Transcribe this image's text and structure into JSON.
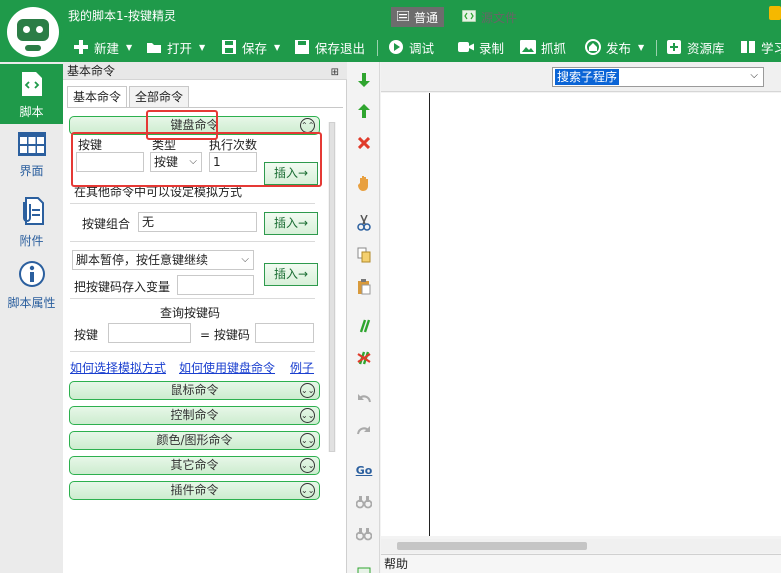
{
  "window": {
    "title": "我的脚本1-按键精灵"
  },
  "toolbar": {
    "new": "新建",
    "open": "打开",
    "save": "保存",
    "save_exit": "保存退出",
    "debug": "调试",
    "record": "录制",
    "capture": "抓抓",
    "publish": "发布",
    "resources": "资源库",
    "learn": "学习"
  },
  "leftnav": {
    "items": [
      {
        "label": "脚本"
      },
      {
        "label": "界面"
      },
      {
        "label": "附件"
      },
      {
        "label": "脚本属性"
      }
    ]
  },
  "panel": {
    "header": "基本命令",
    "tabs": [
      "基本命令",
      "全部命令"
    ],
    "keyboard_section": "键盘命令",
    "key_label": "按键",
    "type_label": "类型",
    "times_label": "执行次数",
    "type_value": "按键",
    "times_value": "1",
    "insert": "插入→",
    "note": "在其他命令中可以设定模拟方式",
    "combo_label": "按键组合",
    "combo_value": "无",
    "pause_select": "脚本暂停，按任意键继续",
    "store_var_label": "把按键码存入变量",
    "query_title": "查询按键码",
    "query_key_label": "按键",
    "query_code_label": "= 按键码",
    "links": [
      "如何选择模拟方式",
      "如何使用键盘命令",
      "例子"
    ],
    "sections": [
      "鼠标命令",
      "控制命令",
      "颜色/图形命令",
      "其它命令",
      "插件命令"
    ]
  },
  "editor": {
    "tab_normal": "普通",
    "tab_source": "源文件",
    "proc_select": "搜索子程序",
    "help": "帮助"
  },
  "colors": {
    "brand_green": "#1f9a4a",
    "highlight_red": "#e53935",
    "link_blue": "#1a3fcf"
  }
}
